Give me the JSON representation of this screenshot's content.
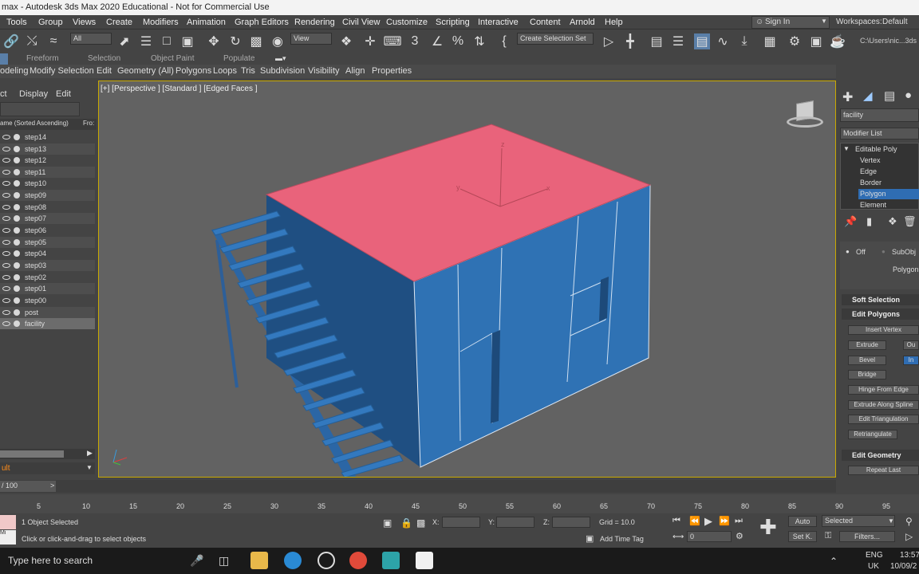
{
  "window": {
    "title": "max - Autodesk 3ds Max 2020 Educational - Not for Commercial Use"
  },
  "menu": [
    "Tools",
    "Group",
    "Views",
    "Create",
    "Modifiers",
    "Animation",
    "Graph Editors",
    "Rendering",
    "Civil View",
    "Customize",
    "Scripting",
    "Interactive",
    "Content",
    "Arnold",
    "Help"
  ],
  "signin": "Sign In",
  "workspaces": {
    "label": "Workspaces:",
    "value": "Default"
  },
  "toolbar": {
    "filter": "All",
    "view": "View",
    "selection_set": "Create Selection Set",
    "path": "C:\\Users\\nic...3ds Max"
  },
  "ribbon_tabs": [
    "Freeform",
    "Selection",
    "Object Paint",
    "Populate"
  ],
  "ribbon_items": [
    "odeling",
    "Modify Selection",
    "Edit",
    "Geometry (All)",
    "Polygons",
    "Loops",
    "Tris",
    "Subdivision",
    "Visibility",
    "Align",
    "Properties"
  ],
  "explorer": {
    "tabs": [
      "ct",
      "Display",
      "Edit"
    ],
    "column_header": "ame (Sorted Ascending)",
    "column_header2": "Fro:",
    "objects": [
      "step14",
      "step13",
      "step12",
      "step11",
      "step10",
      "step09",
      "step08",
      "step07",
      "step06",
      "step05",
      "step04",
      "step03",
      "step02",
      "step01",
      "step00",
      "post",
      "facility"
    ],
    "layer": "ult"
  },
  "viewport": {
    "label": "[+] [Perspective ] [Standard ] [Edged Faces ]",
    "gizmo_axes": [
      "z",
      "y",
      "x"
    ]
  },
  "command_panel": {
    "object_name": "facility",
    "modifier_list": "Modifier List",
    "stack": [
      "Editable Poly",
      "Vertex",
      "Edge",
      "Border",
      "Polygon",
      "Element"
    ],
    "selected_subobject": "Polygon",
    "off_label": "Off",
    "subobj_label": "SubObj",
    "preview_polygon": "Polygon",
    "rollouts": [
      "Soft Selection",
      "Edit Polygons",
      "Edit Geometry"
    ],
    "buttons": [
      "Insert Vertex",
      "Extrude",
      "Ou",
      "Bevel",
      "In",
      "Bridge",
      "Hinge From Edge",
      "Extrude Along Spline",
      "Edit Triangulation",
      "Retriangulate",
      "Repeat Last"
    ]
  },
  "timeline": {
    "frame_display": "/ 100",
    "ticks": [
      "5",
      "10",
      "15",
      "20",
      "25",
      "30",
      "35",
      "40",
      "45",
      "50",
      "55",
      "60",
      "65",
      "70",
      "75",
      "80",
      "85",
      "90",
      "95"
    ]
  },
  "status": {
    "selected_count": "1 Object Selected",
    "hint": "Click or click-and-drag to select objects",
    "x_label": "X:",
    "y_label": "Y:",
    "z_label": "Z:",
    "grid": "Grid = 10.0",
    "add_time_tag": "Add Time Tag",
    "auto": "Auto",
    "selected_dropdown": "Selected",
    "set_key": "Set K.",
    "filters": "Filters...",
    "frame": "0",
    "mini": "Mi"
  },
  "taskbar": {
    "search_placeholder": "Type here to search",
    "lang": "ENG",
    "region": "UK",
    "time": "13:57",
    "date": "10/09/2"
  },
  "colors": {
    "viewport_bg": "#626262",
    "box_top": "#e9637b",
    "box_sides": "#2f72b4",
    "selection_border": "#c9a900"
  }
}
